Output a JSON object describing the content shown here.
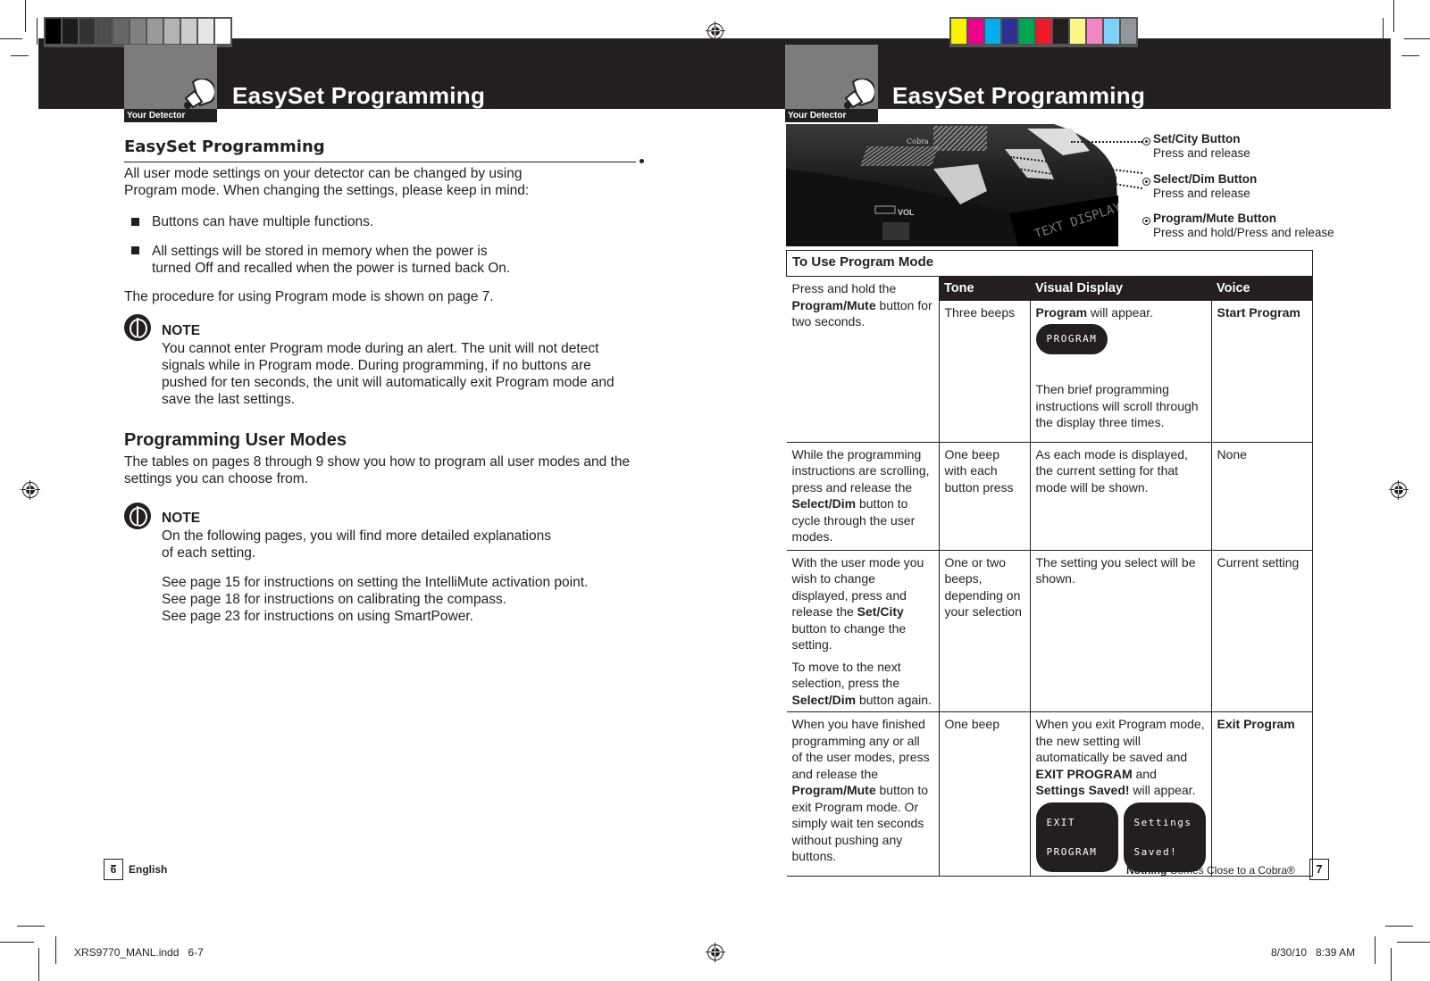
{
  "slug": {
    "file": "XRS9770_MANL.indd   6-7",
    "timestamp": "8/30/10   8:39 AM"
  },
  "swatches": {
    "grayscale": [
      "#000000",
      "#1c1c1c",
      "#333333",
      "#4d4d4d",
      "#666666",
      "#808080",
      "#999999",
      "#b3b3b3",
      "#cccccc",
      "#e6e6e6",
      "#ffffff"
    ],
    "color": [
      "#fff200",
      "#ec008c",
      "#00aeef",
      "#2e3192",
      "#00a651",
      "#ed1c24",
      "#231f20",
      "#fff685",
      "#f584c4",
      "#7dd3f7",
      "#939598"
    ]
  },
  "left_page": {
    "header": {
      "tab_label": "Your Detector",
      "title": "EasySet Programming",
      "icon": "radar-dish-icon"
    },
    "section_title": "EasySet Programming",
    "intro": [
      "All user mode settings on your detector can be changed by using",
      "Program mode. When changing the settings, please keep in mind:"
    ],
    "bullets": [
      {
        "line1": "Buttons can have multiple functions."
      },
      {
        "line1": "All settings will be stored in memory when the power is",
        "line2": "turned Off and recalled when the power is turned back On."
      }
    ],
    "procedure": "The procedure for using Program mode is shown on page 7.",
    "note1": {
      "label": "NOTE",
      "lines": [
        "You cannot enter Program mode during an alert. The unit will not detect",
        "signals while in Program mode. During programming, if no buttons are",
        "pushed for ten seconds, the unit will automatically exit Program mode and",
        "save the last settings."
      ]
    },
    "subsection_title": "Programming User Modes",
    "subsection_text": [
      "The tables on pages 8 through 9 show you how to program all user modes and the",
      "settings you can choose from."
    ],
    "note2": {
      "label": "NOTE",
      "lines": [
        "On the following pages, you will find more detailed explanations",
        "of each setting."
      ],
      "see_lines": [
        "See page 15 for instructions on setting the IntelliMute activation point.",
        "See page 18 for instructions on calibrating the compass.",
        "See page 23 for instructions on using SmartPower."
      ]
    },
    "footer": {
      "page_number": "6",
      "language": "English"
    }
  },
  "right_page": {
    "header": {
      "tab_label": "Your Detector",
      "title": "EasySet Programming",
      "icon": "radar-dish-icon"
    },
    "detector_image": {
      "display_text": "TEXT DISPLAY",
      "vol_label": "VOL",
      "brand": "Cobra"
    },
    "callouts": [
      {
        "title": "Set/City Button",
        "desc": "Press and release"
      },
      {
        "title": "Select/Dim Button",
        "desc": "Press and release"
      },
      {
        "title": "Program/Mute Button",
        "desc": "Press and hold/Press and release"
      }
    ],
    "table": {
      "title": "To Use Program Mode",
      "headers": {
        "tone": "Tone",
        "visual": "Visual Display",
        "voice": "Voice"
      },
      "rows": [
        {
          "action_pre": "Press and hold the",
          "action_bold": "Program/Mute",
          "action_post": " button for two seconds.",
          "tone": "Three beeps",
          "visual_bold": "Program",
          "visual_post": " will appear.",
          "lcd": "PROGRAM",
          "visual_extra": "Then brief programming instructions will scroll through the display three times.",
          "voice": "Start Program"
        },
        {
          "action_pre": "While the programming instructions are scrolling, press and release the ",
          "action_bold": "Select/Dim",
          "action_post": " button to cycle through the user modes.",
          "tone": "One beep with each button press",
          "visual": "As each mode is displayed, the current setting for that mode will be shown.",
          "voice": "None"
        },
        {
          "action_pre": "With the user mode you wish to change displayed, press and release the ",
          "action_bold": "Set/City",
          "action_post": " button to change the setting.",
          "action2_pre": "To move to the next selection, press the ",
          "action2_bold": "Select/Dim",
          "action2_post": " button again.",
          "tone": "One or two beeps, depending on your selection",
          "visual": "The setting you select will be shown.",
          "voice": "Current setting"
        },
        {
          "action_pre": "When you have finished programming any or all of the user modes, press and release the ",
          "action_bold": "Program/Mute",
          "action_post": " button to exit Program mode. Or simply wait ten seconds without pushing any buttons.",
          "tone": "One beep",
          "visual_pre": "When you exit Program mode, the new setting will automatically be saved and ",
          "visual_bold1": "EXIT PROGRAM",
          "visual_mid": " and ",
          "visual_bold2": "Settings Saved!",
          "visual_post": " will appear.",
          "lcd_left": [
            "EXIT",
            "PROGRAM"
          ],
          "lcd_right": [
            "Settings",
            "Saved!"
          ],
          "voice": "Exit Program"
        }
      ]
    },
    "footer": {
      "tagline_bold": "Nothing",
      "tagline": " Comes Close to a Cobra®",
      "page_number": "7"
    }
  }
}
